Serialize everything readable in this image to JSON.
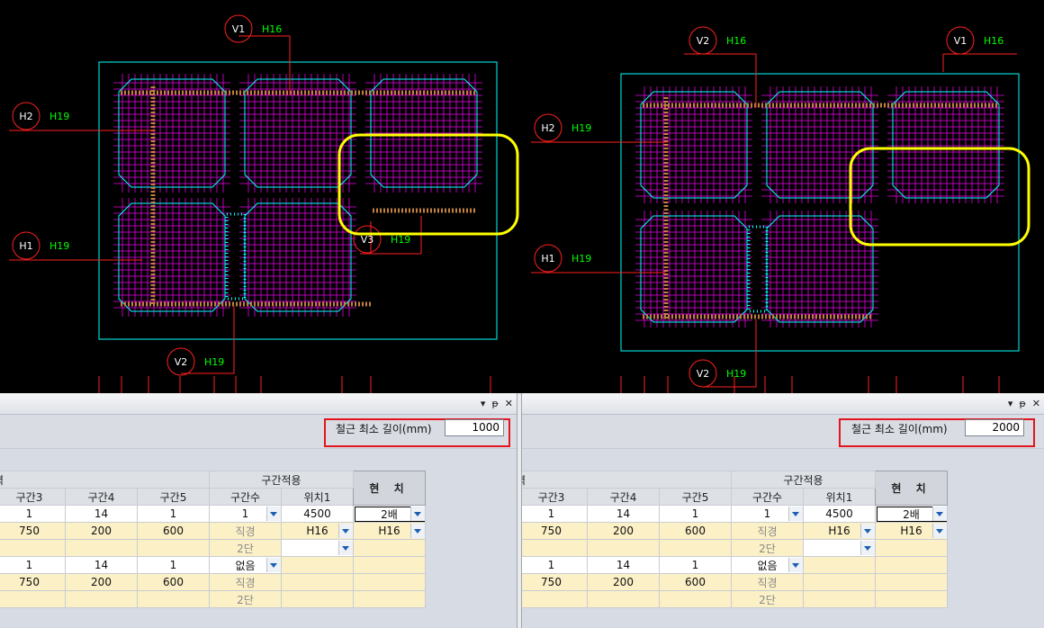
{
  "cad": {
    "left": {
      "tags": [
        {
          "id": "V1",
          "bar": "H16"
        },
        {
          "id": "H2",
          "bar": "H19"
        },
        {
          "id": "H1",
          "bar": "H19"
        },
        {
          "id": "V3",
          "bar": "H19"
        },
        {
          "id": "V2",
          "bar": "H19"
        }
      ]
    },
    "right": {
      "tags": [
        {
          "id": "V2",
          "bar": "H16"
        },
        {
          "id": "V1",
          "bar": "H16"
        },
        {
          "id": "H2",
          "bar": "H19"
        },
        {
          "id": "H1",
          "bar": "H19"
        },
        {
          "id": "V2",
          "bar": "H19"
        }
      ]
    },
    "colors": {
      "rebar": "#ff00ff",
      "outline": "#00ffff",
      "leader": "#ff2020",
      "label": "#00ff00",
      "highlight": "#ffff00"
    }
  },
  "titlebar_icons": [
    "▾",
    "ᵽ",
    "✕"
  ],
  "left_panel": {
    "min_length_label": "철근 최소 길이(mm)",
    "min_length_value": "1000",
    "header_partial": "력",
    "group_header": "구간적용",
    "hyunchi": "현 치",
    "columns": [
      "구간3",
      "구간4",
      "구간5",
      "구간수",
      "위치1"
    ],
    "rows": [
      {
        "c": [
          "1",
          "14",
          "1",
          "1",
          "4500",
          "2배"
        ]
      },
      {
        "c": [
          "750",
          "200",
          "600",
          "직경",
          "H16",
          "H16"
        ]
      },
      {
        "c": [
          "",
          "",
          "",
          "2단",
          "",
          ""
        ]
      },
      {
        "c": [
          "1",
          "14",
          "1",
          "없음",
          "",
          ""
        ]
      },
      {
        "c": [
          "750",
          "200",
          "600",
          "직경",
          "",
          ""
        ]
      },
      {
        "c": [
          "",
          "",
          "",
          "2단",
          "",
          ""
        ]
      }
    ]
  },
  "right_panel": {
    "min_length_label": "철근 최소 길이(mm)",
    "min_length_value": "2000",
    "header_partial": "력",
    "group_header": "구간적용",
    "hyunchi": "현 치",
    "columns": [
      "구간3",
      "구간4",
      "구간5",
      "구간수",
      "위치1"
    ],
    "rows": [
      {
        "c": [
          "1",
          "14",
          "1",
          "1",
          "4500",
          "2배"
        ]
      },
      {
        "c": [
          "750",
          "200",
          "600",
          "직경",
          "H16",
          "H16"
        ]
      },
      {
        "c": [
          "",
          "",
          "",
          "2단",
          "",
          ""
        ]
      },
      {
        "c": [
          "1",
          "14",
          "1",
          "없음",
          "",
          ""
        ]
      },
      {
        "c": [
          "750",
          "200",
          "600",
          "직경",
          "",
          ""
        ]
      },
      {
        "c": [
          "",
          "",
          "",
          "2단",
          "",
          ""
        ]
      }
    ]
  }
}
